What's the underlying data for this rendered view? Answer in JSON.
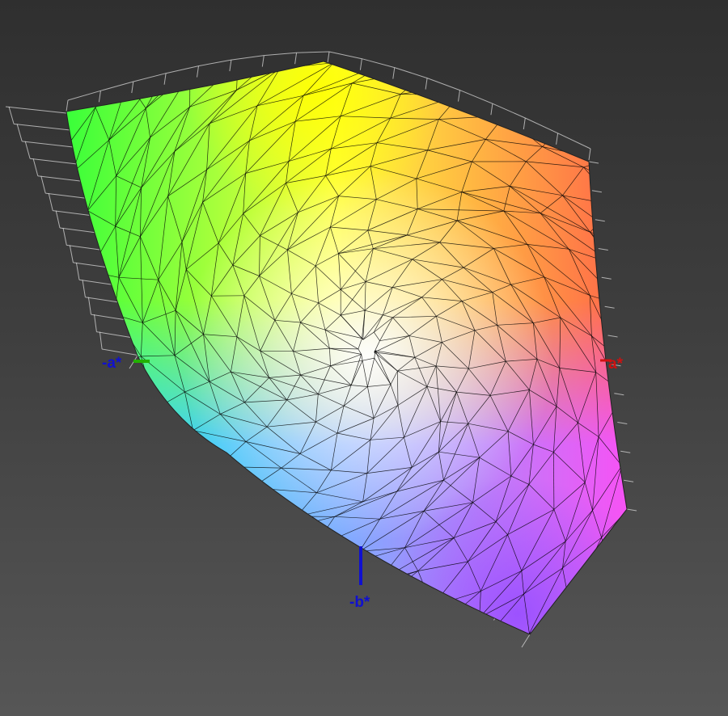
{
  "axes": {
    "neg_a": {
      "label": "-a*",
      "color": "#1010d0",
      "tick_color": "#22b000"
    },
    "pos_a": {
      "label": "a*",
      "color": "#d01010"
    },
    "neg_b": {
      "label": "-b*",
      "color": "#1010d0"
    }
  },
  "colors": {
    "background_top": "#2f2f2f",
    "background_bottom": "#565656",
    "wireframe_inner": "#000000",
    "wireframe_outer": "#e0e0e0"
  },
  "gamut_corners": {
    "top": "yellow",
    "top_left": "green",
    "right": "red",
    "left_bottom": "cyan",
    "bottom_right": "magenta",
    "bottom": "violet"
  }
}
